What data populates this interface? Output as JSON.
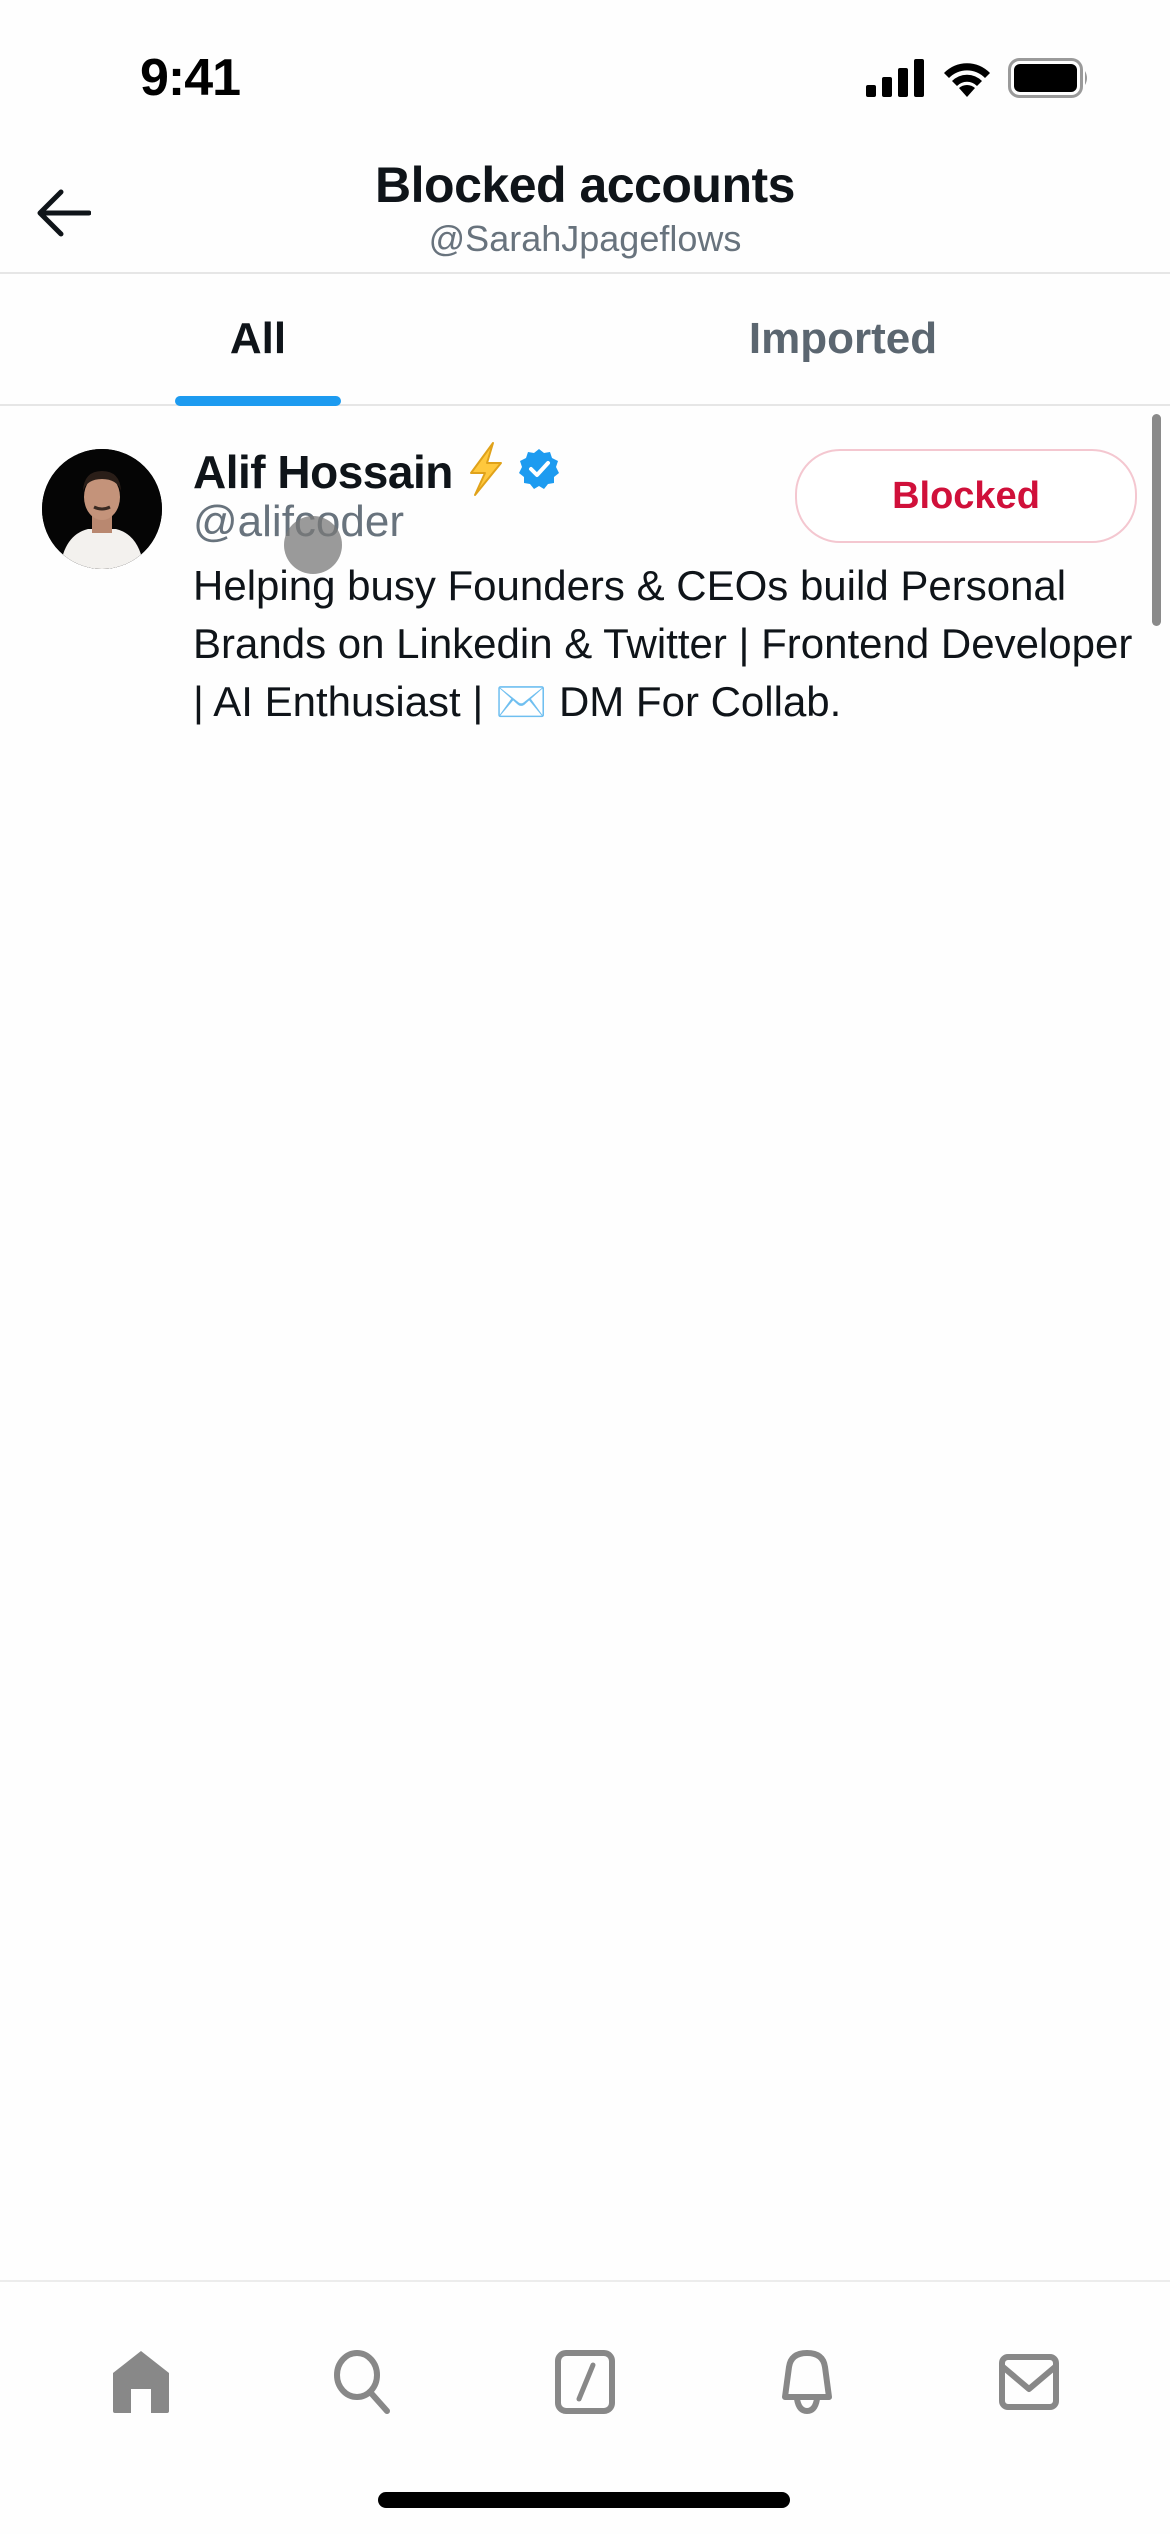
{
  "status_bar": {
    "time": "9:41",
    "icons": [
      "signal-icon",
      "wifi-icon",
      "battery-icon"
    ]
  },
  "header": {
    "back_icon": "arrow-left-icon",
    "title": "Blocked accounts",
    "subtitle": "@SarahJpageflows"
  },
  "tabs": [
    {
      "label": "All",
      "active": true
    },
    {
      "label": "Imported",
      "active": false
    }
  ],
  "accounts": [
    {
      "name": "Alif Hossain",
      "name_emoji": "⚡",
      "verified": true,
      "handle": "@alifcoder",
      "bio": "Helping busy Founders & CEOs build Personal Brands on Linkedin & Twitter | Frontend Developer | AI Enthusiast | ✉️ DM For Collab.",
      "button_label": "Blocked"
    }
  ],
  "colors": {
    "accent": "#1d9bf0",
    "blocked_red": "#d0103a",
    "blocked_border": "#f4c7d0",
    "secondary_text": "#68737d",
    "icon_gray": "#888888"
  },
  "bottom_nav": [
    {
      "name": "home",
      "icon": "home-icon"
    },
    {
      "name": "search",
      "icon": "search-icon"
    },
    {
      "name": "compose",
      "icon": "compose-icon"
    },
    {
      "name": "notifications",
      "icon": "bell-icon"
    },
    {
      "name": "messages",
      "icon": "mail-icon"
    }
  ]
}
